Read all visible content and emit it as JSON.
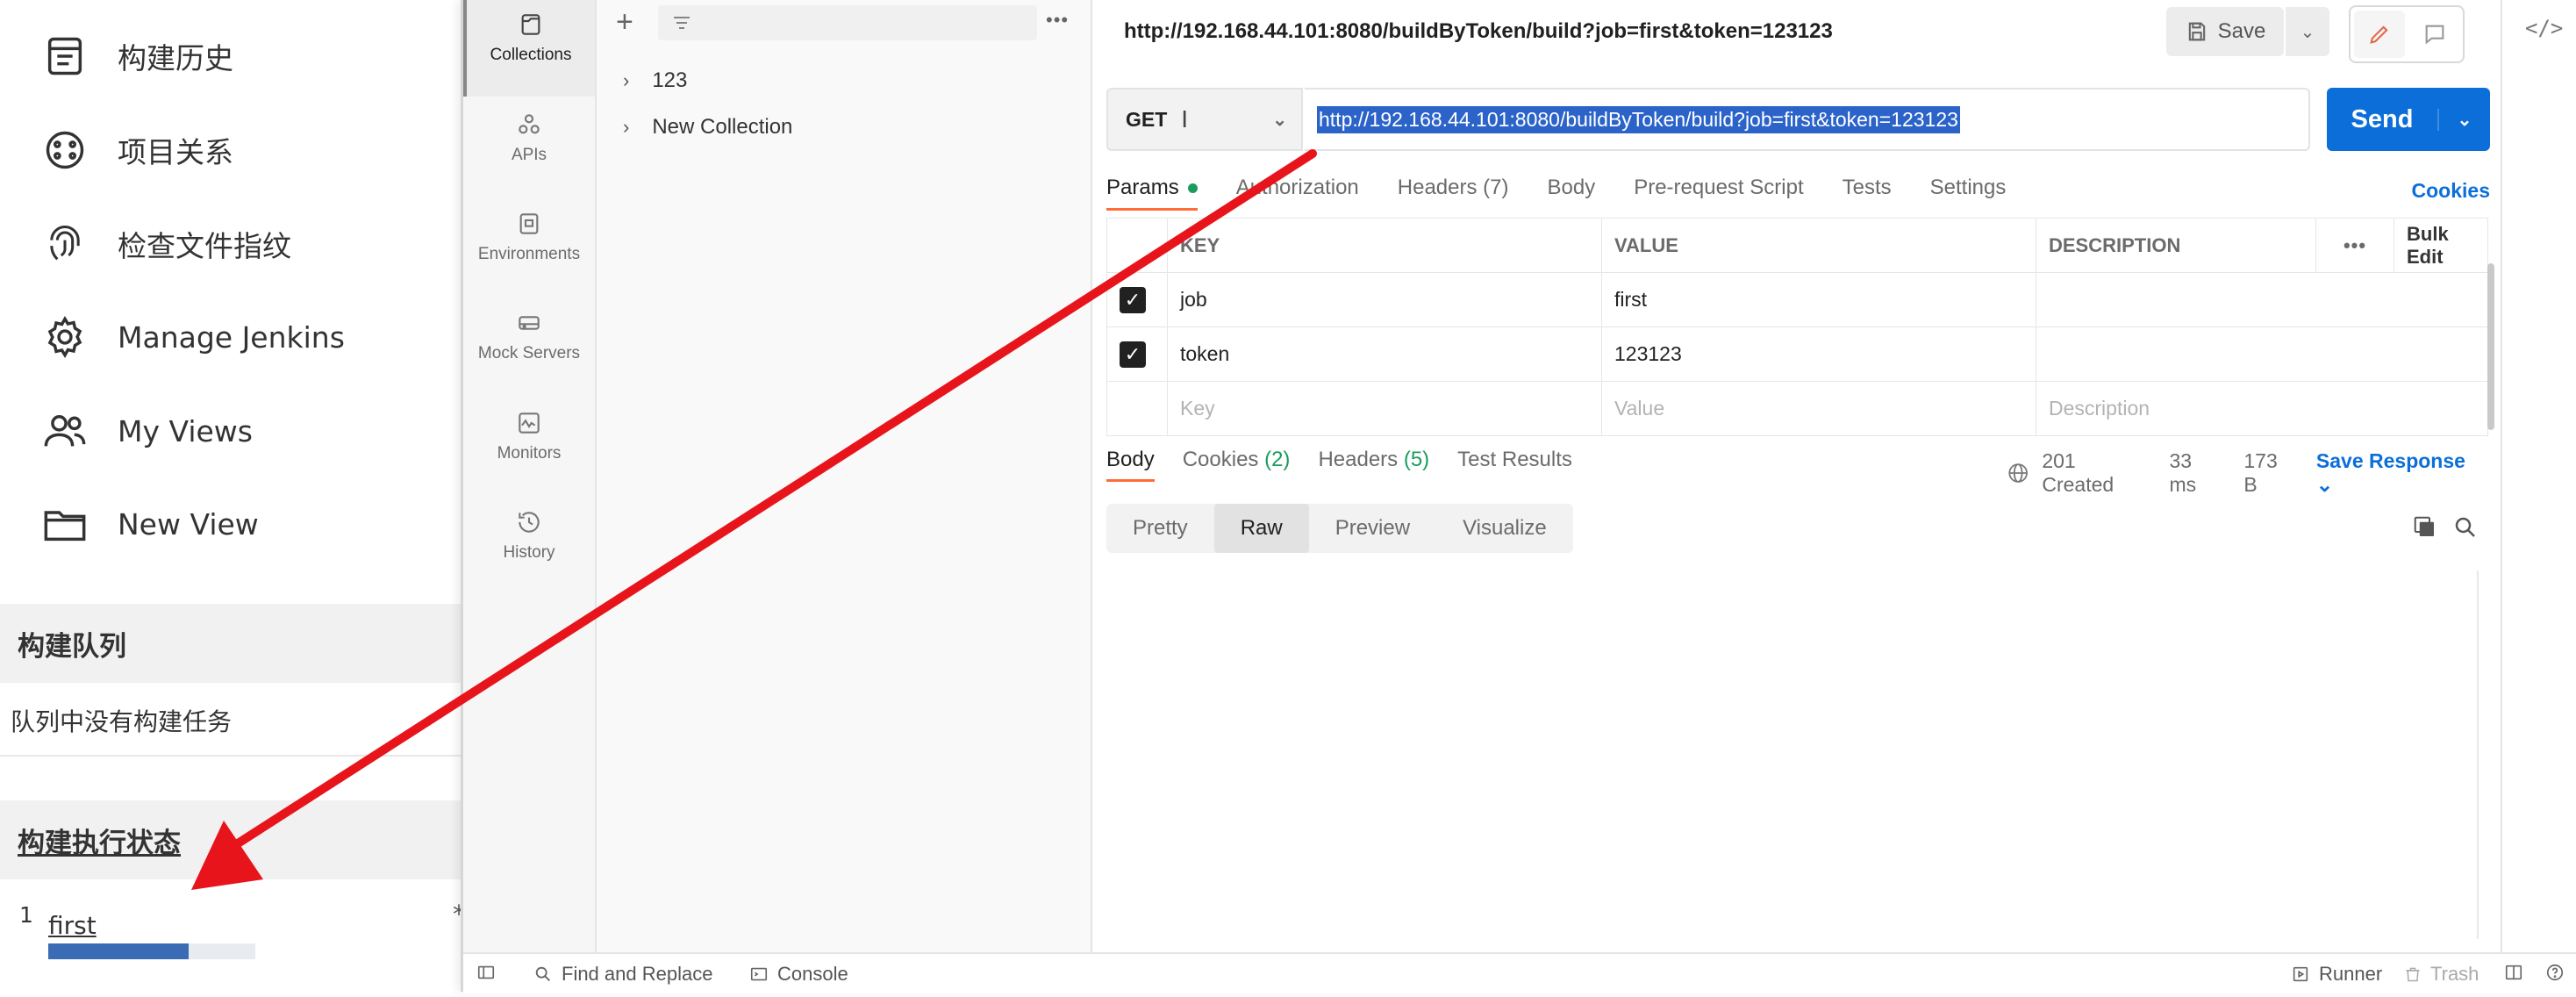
{
  "jenkins": {
    "nav": [
      {
        "label": "构建历史",
        "icon": "notepad-icon"
      },
      {
        "label": "项目关系",
        "icon": "relationship-icon"
      },
      {
        "label": "检查文件指纹",
        "icon": "fingerprint-icon"
      },
      {
        "label": "Manage Jenkins",
        "icon": "gear-icon"
      },
      {
        "label": "My Views",
        "icon": "people-icon"
      },
      {
        "label": "New View",
        "icon": "folder-icon"
      }
    ],
    "queue_title": "构建队列",
    "queue_empty": "队列中没有构建任务",
    "executor_title": "构建执行状态",
    "executor_index": "1",
    "executor_job": "first",
    "executor_progress": 0.68,
    "cut_char": "*"
  },
  "postman": {
    "rail": [
      {
        "label": "Collections",
        "icon": "collections-icon",
        "active": true
      },
      {
        "label": "APIs",
        "icon": "apis-icon"
      },
      {
        "label": "Environments",
        "icon": "environments-icon"
      },
      {
        "label": "Mock Servers",
        "icon": "mock-servers-icon"
      },
      {
        "label": "Monitors",
        "icon": "monitors-icon"
      },
      {
        "label": "History",
        "icon": "history-icon"
      }
    ],
    "collections": [
      "123",
      "New Collection"
    ],
    "tab_url": "http://192.168.44.101:8080/buildByToken/build?job=first&token=123123",
    "save_label": "Save",
    "method": "GET",
    "request_url": "http://192.168.44.101:8080/buildByToken/build?job=first&token=123123",
    "send_label": "Send",
    "request_tabs": [
      "Params",
      "Authorization",
      "Headers (7)",
      "Body",
      "Pre-request Script",
      "Tests",
      "Settings"
    ],
    "cookies_label": "Cookies",
    "params_headers": {
      "key": "KEY",
      "value": "VALUE",
      "description": "DESCRIPTION",
      "bulk": "Bulk Edit"
    },
    "params": [
      {
        "key": "job",
        "value": "first",
        "checked": true
      },
      {
        "key": "token",
        "value": "123123",
        "checked": true
      }
    ],
    "params_placeholders": {
      "key": "Key",
      "value": "Value",
      "description": "Description"
    },
    "response_tabs": {
      "body": "Body",
      "cookies": "Cookies",
      "cookies_count": "(2)",
      "headers": "Headers",
      "headers_count": "(5)",
      "tests": "Test Results"
    },
    "response_meta": {
      "status": "201 Created",
      "time": "33 ms",
      "size": "173 B",
      "save": "Save Response"
    },
    "format_tabs": [
      "Pretty",
      "Raw",
      "Preview",
      "Visualize"
    ],
    "status_bar": {
      "find_replace": "Find and Replace",
      "console": "Console",
      "runner": "Runner",
      "trash": "Trash"
    }
  },
  "colors": {
    "accent": "#0c6fd9",
    "arrow": "#e8141b",
    "progress": "#3a6bb5"
  }
}
